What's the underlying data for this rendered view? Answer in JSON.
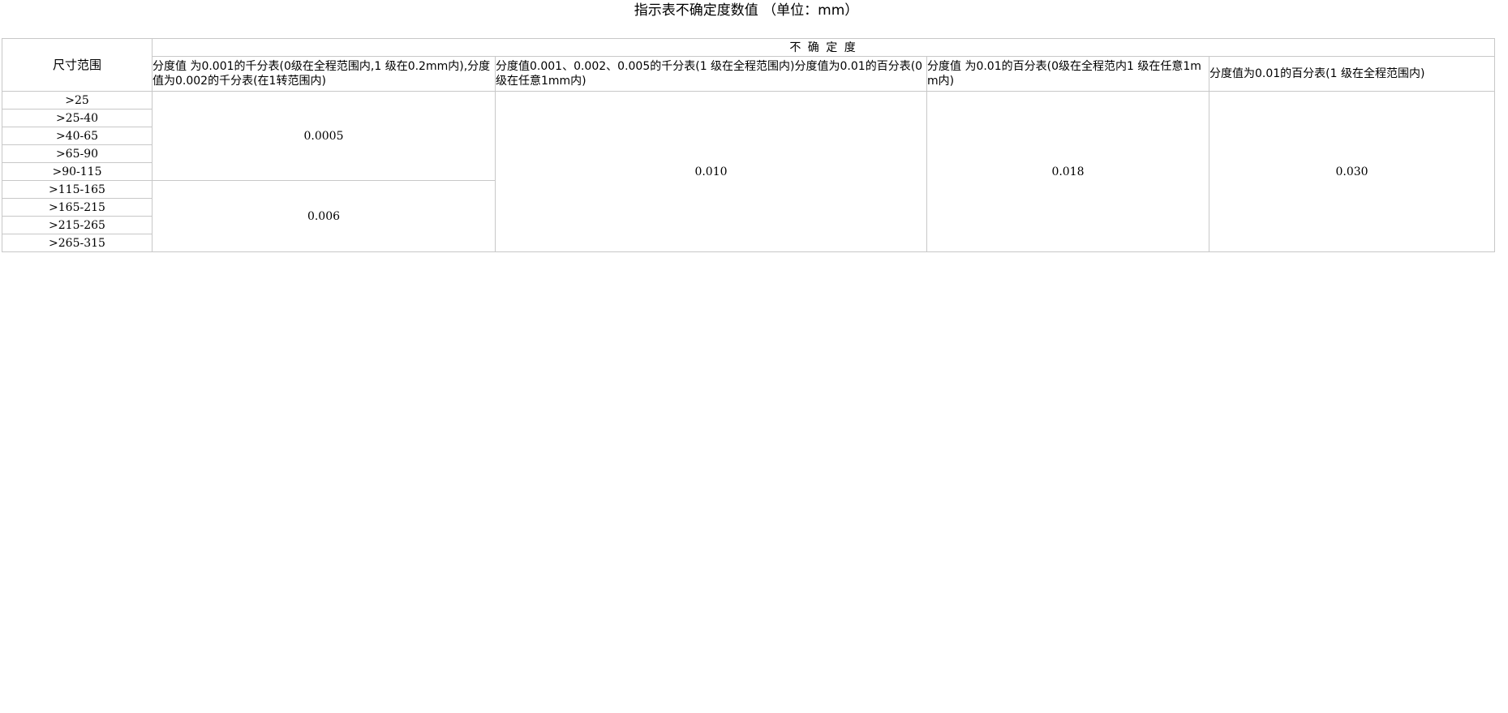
{
  "page": {
    "caption": "指示表不确定度数值 （单位：mm）"
  },
  "table": {
    "row_header": "尺寸范围",
    "group_header": "不 确 定 度",
    "columns": [
      "分度值 为0.001的千分表(0级在全程范围内,1 级在0.2mm内),分度值为0.002的千分表(在1转范围内)",
      "分度值0.001、0.002、0.005的千分表(1 级在全程范围内)分度值为0.01的百分表(0级在任意1mm内)",
      "分度值 为0.01的百分表(0级在全程范内1 级在任意1mm内)",
      "分度值为0.01的百分表(1 级在全程范围内)"
    ],
    "ranges": [
      ">25",
      ">25-40",
      ">40-65",
      ">65-90",
      ">90-115",
      ">115-165",
      ">165-215",
      ">215-265",
      ">265-315"
    ],
    "values": {
      "col1_group1": "0.0005",
      "col1_group2": "0.006",
      "col2": "0.010",
      "col3": "0.018",
      "col4": "0.030"
    }
  }
}
